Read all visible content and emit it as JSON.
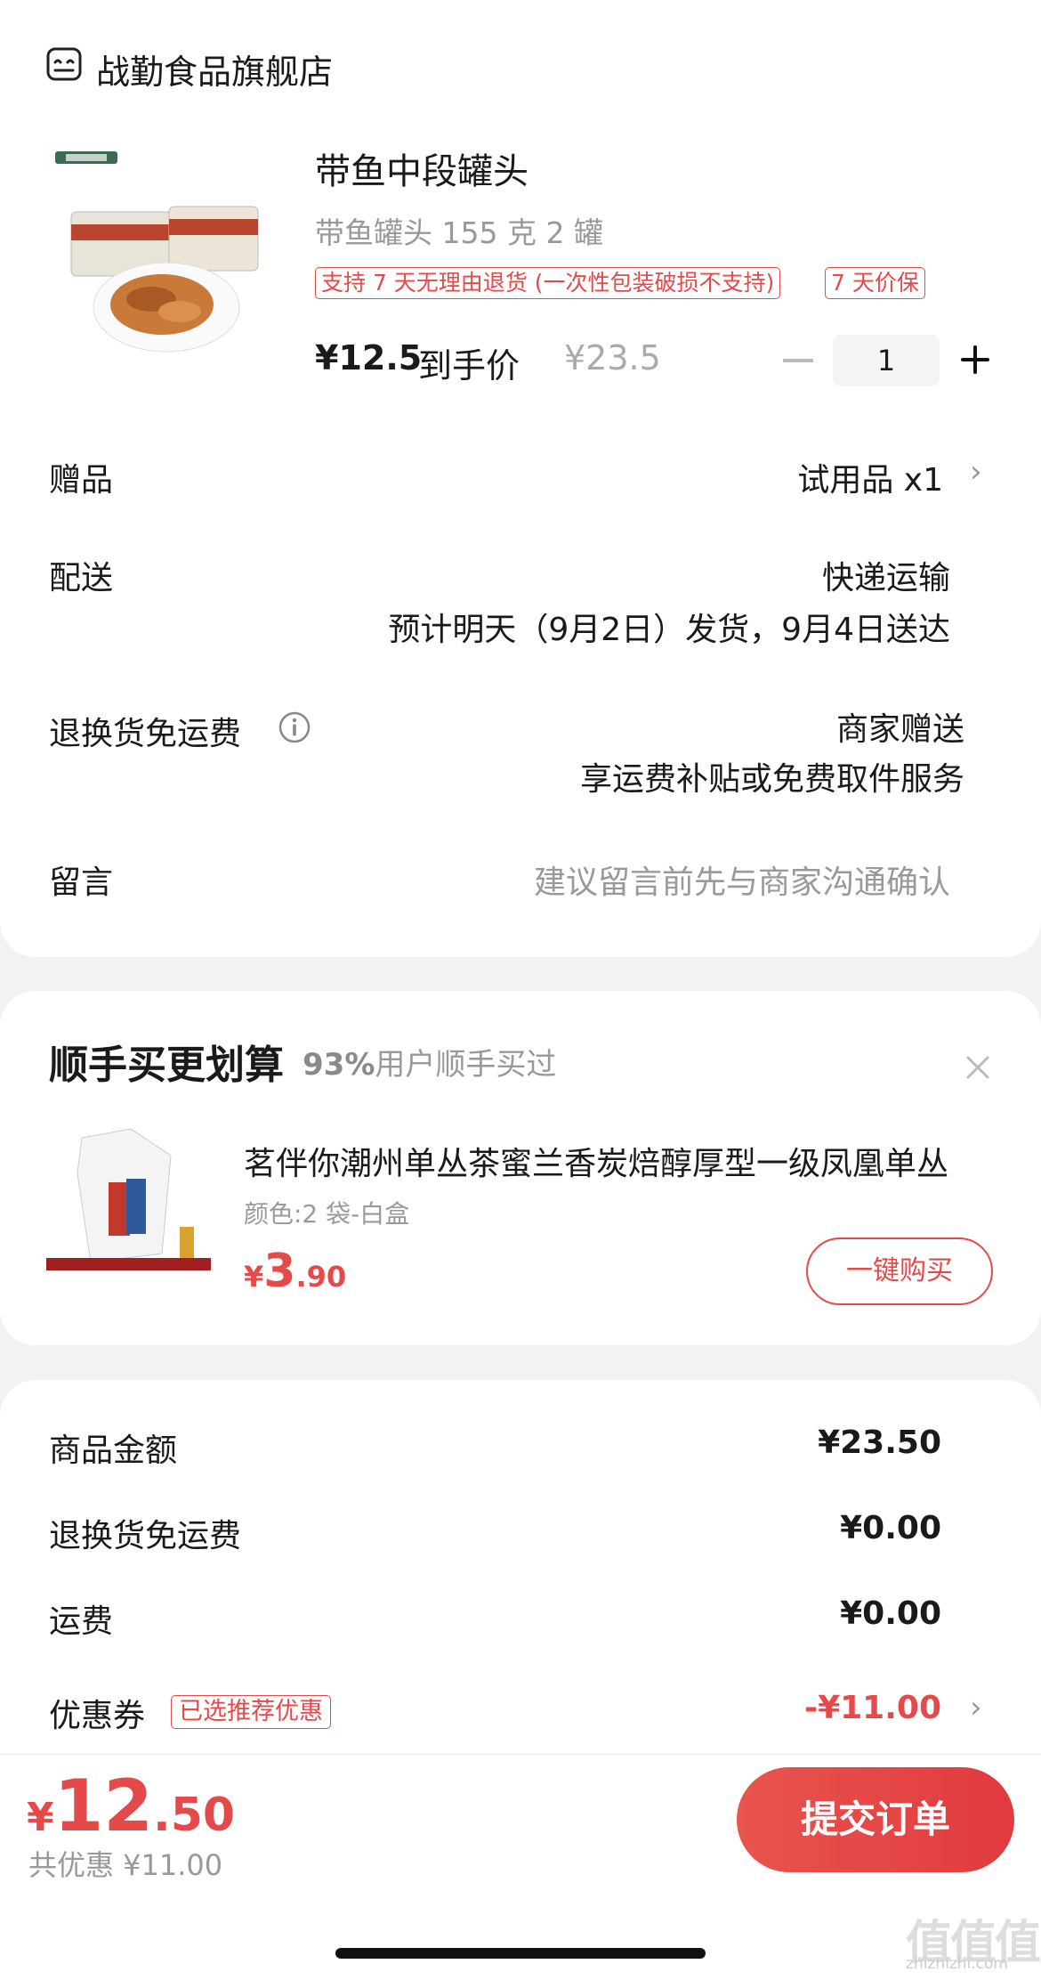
{
  "store": {
    "name": "战勤食品旗舰店",
    "icon": "shop-icon"
  },
  "product": {
    "title": "带鱼中段罐头",
    "spec": "带鱼罐头 155 克 2 罐",
    "tags": [
      "支持 7 天无理由退货 (一次性包装破损不支持)",
      "7 天价保"
    ],
    "price_now": "¥12.5",
    "price_label": "到手价",
    "price_old": "¥23.5",
    "quantity": "1"
  },
  "rows": {
    "gift_label": "赠品",
    "gift_value": "试用品 x1",
    "delivery_label": "配送",
    "delivery_method": "快递运输",
    "delivery_eta": "预计明天（9月2日）发货，9月4日送达",
    "return_label": "退换货免运费",
    "return_value": "商家赠送",
    "return_desc": "享运费补贴或免费取件服务",
    "message_label": "留言",
    "message_placeholder": "建议留言前先与商家沟通确认"
  },
  "recommend": {
    "title": "顺手买更划算",
    "percent": "93%",
    "subtitle": "用户顺手买过",
    "item_name": "茗伴你潮州单丛茶蜜兰香炭焙醇厚型一级凤凰单丛",
    "item_spec": "颜色:2 袋-白盒",
    "price_symbol": "¥",
    "price_int": "3",
    "price_dec": ".90",
    "button": "一键购买"
  },
  "summary": {
    "goods_label": "商品金额",
    "goods_value": "¥23.50",
    "return_label": "退换货免运费",
    "return_value": "¥0.00",
    "shipping_label": "运费",
    "shipping_value": "¥0.00",
    "coupon_label": "优惠券",
    "coupon_tag": "已选推荐优惠",
    "coupon_value": "-¥11.00"
  },
  "footer": {
    "total_symbol": "¥",
    "total_int": "12",
    "total_dec": ".50",
    "saved": "共优惠 ¥11.00",
    "submit": "提交订单"
  },
  "watermark": {
    "main": "值值值",
    "sub": "zhizhizhi.com"
  },
  "colors": {
    "accent": "#e54a4a",
    "muted": "#999999",
    "background": "#f2f2f2"
  }
}
